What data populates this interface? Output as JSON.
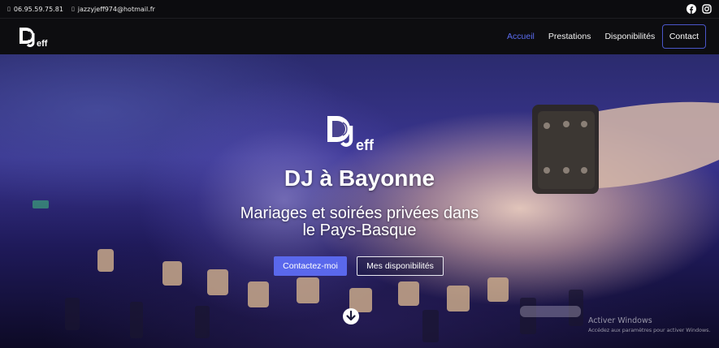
{
  "topbar": {
    "phone": "06.95.59.75.81",
    "email": "jazzyjeff974@hotmail.fr",
    "phone_icon": "phone-icon",
    "email_icon": "envelope-icon",
    "social": [
      "facebook-icon",
      "instagram-icon"
    ]
  },
  "brand": {
    "logo_letters": "D",
    "logo_j": "J",
    "logo_word": "eff"
  },
  "nav": {
    "items": [
      {
        "label": "Accueil",
        "active": true
      },
      {
        "label": "Prestations",
        "active": false
      },
      {
        "label": "Disponibilités",
        "active": false
      }
    ],
    "contact_label": "Contact"
  },
  "hero": {
    "title": "DJ à Bayonne",
    "subtitle_line1": "Mariages et soirées privées dans",
    "subtitle_line2": "le Pays-Basque",
    "primary_button": "Contactez-moi",
    "secondary_button": "Mes disponibilités",
    "scroll_icon": "arrow-down-circle-icon"
  },
  "watermark": {
    "line1": "Activer Windows",
    "line2": "Accédez aux paramètres pour activer Windows."
  },
  "colors": {
    "accent": "#5b6cf0",
    "topbar_bg": "#0c0c0f",
    "navbar_bg": "#0d0d10"
  }
}
